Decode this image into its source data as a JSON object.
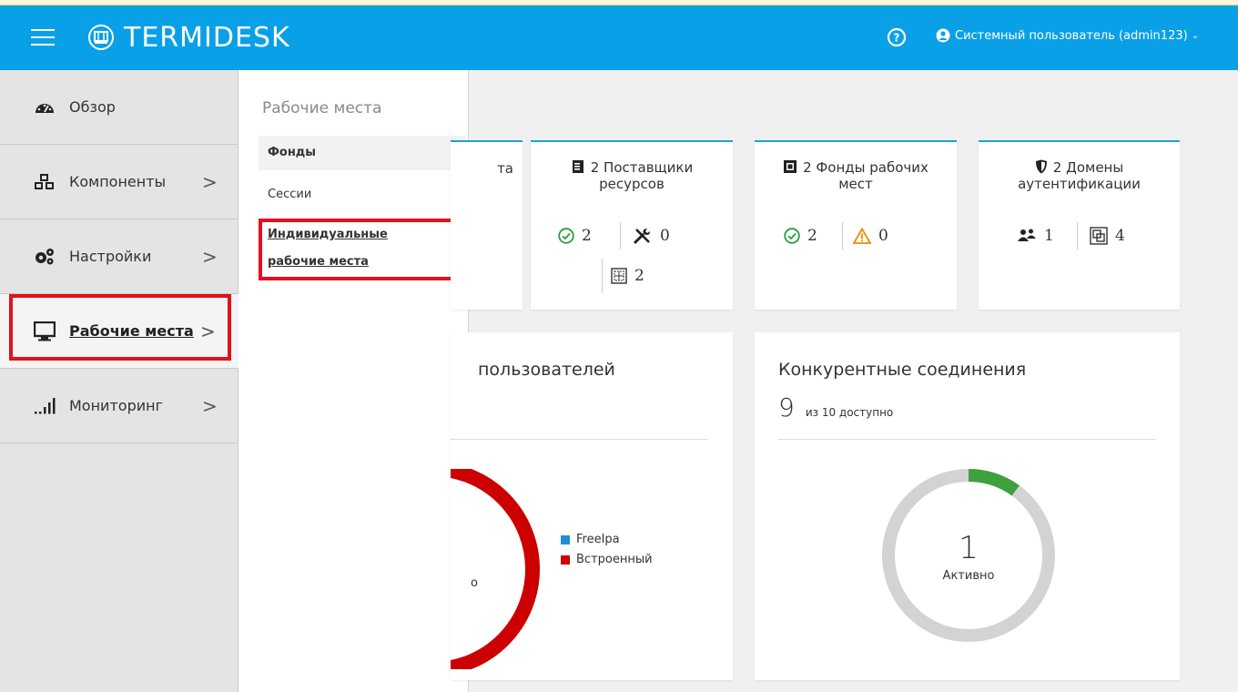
{
  "header": {
    "logo_text": "TERMIDESK",
    "user_label": "Системный пользователь (admin123)"
  },
  "sidebar": {
    "items": [
      {
        "label": "Обзор"
      },
      {
        "label": "Компоненты"
      },
      {
        "label": "Настройки"
      },
      {
        "label": "Рабочие места"
      },
      {
        "label": "Мониторинг"
      }
    ]
  },
  "submenu": {
    "title": "Рабочие места",
    "items": [
      {
        "label": "Фонды"
      },
      {
        "label": "Сессии"
      },
      {
        "label_line1": "Индивидуальные",
        "label_line2": "рабочие места"
      }
    ]
  },
  "cards": [
    {
      "title_partial": "та"
    },
    {
      "title": "2 Поставщики ресурсов",
      "line1": "2 Поставщики",
      "line2": "ресурсов",
      "ok": "2",
      "tools": "0",
      "other": "2"
    },
    {
      "title": "2 Фонды рабочих мест",
      "line1": "2 Фонды рабочих",
      "line2": "мест",
      "ok": "2",
      "warn": "0"
    },
    {
      "title": "2 Домены аутентификации",
      "line1": "2 Домены",
      "line2": "аутентификации",
      "users": "1",
      "other": "4"
    }
  ],
  "users_panel": {
    "title_partial": "пользователей",
    "center_partial": "о",
    "legend": [
      {
        "label": "FreeIpa",
        "color": "#1e8fd0"
      },
      {
        "label": "Встроенный",
        "color": "#cc0000"
      }
    ]
  },
  "connections_panel": {
    "title": "Конкурентные соединения",
    "count": "9",
    "count_suffix": "из 10 доступно",
    "active_value": "1",
    "active_label": "Активно",
    "active_fraction": 0.1
  },
  "colors": {
    "header": "#0aa0e8",
    "highlight": "#e3101e",
    "card_accent": "#1ea0e0"
  }
}
